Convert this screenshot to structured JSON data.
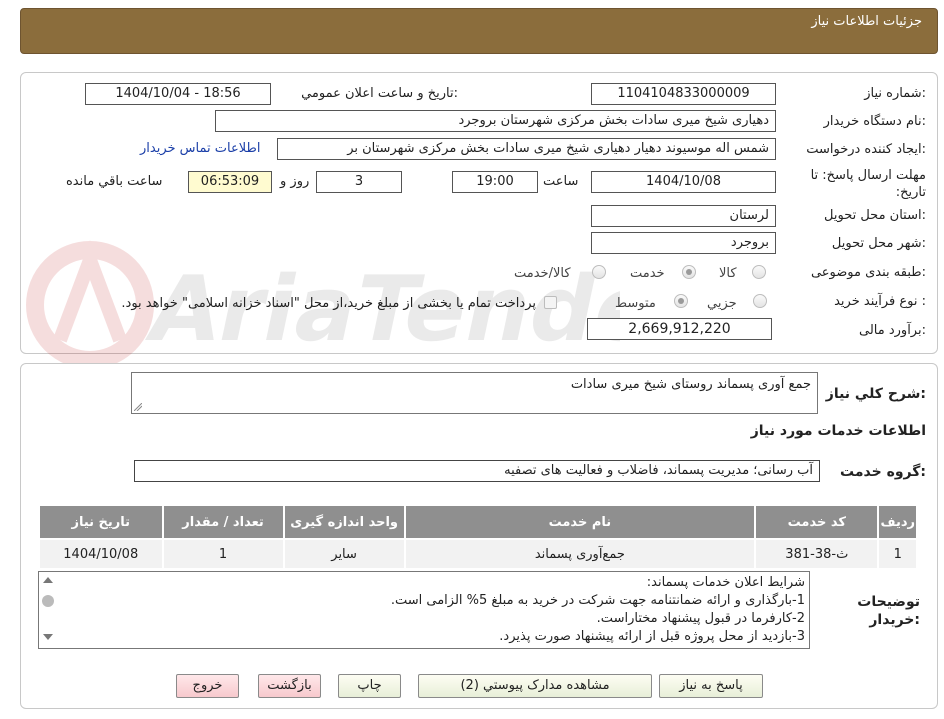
{
  "header": {
    "title": "جزئیات اطلاعات نیاز"
  },
  "form": {
    "need_number": {
      "label": "شماره نیاز:",
      "value": "1104104833000009"
    },
    "announce_datetime": {
      "label": "تاريخ و ساعت اعلان عمومي:",
      "value": "1404/10/04 - 18:56"
    },
    "buyer_org": {
      "label": "نام دستگاه خريدار:",
      "value": "دهیاری شیخ میری سادات بخش مرکزی شهرستان بروجرد"
    },
    "requester": {
      "label": "ایجاد کننده درخواست:",
      "value": "شمس اله موسیوند دهیار دهیاری شیخ میری سادات بخش مرکزی شهرستان بر",
      "contact_link": "اطلاعات تماس خریدار"
    },
    "deadline": {
      "label": "مهلت ارسال پاسخ: تا تاریخ:",
      "date": "1404/10/08",
      "time_label": "ساعت",
      "time": "19:00",
      "days": "3",
      "days_label": "روز و",
      "remaining": "06:53:09",
      "remaining_label": "ساعت باقي مانده"
    },
    "province": {
      "label": "استان محل تحویل:",
      "value": "لرستان"
    },
    "city": {
      "label": "شهر محل تحویل:",
      "value": "بروجرد"
    },
    "category": {
      "label": "طبقه بندی موضوعی:",
      "options": [
        "کالا",
        "خدمت",
        "کالا/خدمت"
      ],
      "selected": "خدمت"
    },
    "purchase_process": {
      "label": "نوع فرآیند خرید :",
      "options": [
        "جزیي",
        "متوسط"
      ],
      "selected": "متوسط",
      "treasury_note": "پرداخت تمام یا بخشی از مبلغ خرید،از محل \"اسناد خزانه اسلامی\" خواهد بود."
    },
    "budget": {
      "label": "برآورد مالی:",
      "value": "2,669,912,220"
    }
  },
  "details": {
    "general_desc_label": "شرح کلي نياز:",
    "general_desc": "جمع آوری پسماند روستای شیخ میری سادات",
    "services_title": "اطلاعات خدمات مورد نياز",
    "service_group_label": "گروه خدمت:",
    "service_group": "آب رسانی؛ مدیریت پسماند، فاضلاب و فعالیت های تصفیه",
    "table": {
      "headers": [
        "ردیف",
        "کد خدمت",
        "نام خدمت",
        "واحد اندازه گیری",
        "تعداد / مقدار",
        "تاریخ نیاز"
      ],
      "rows": [
        [
          "1",
          "ث-38-381",
          "جمع‌آوری پسماند",
          "سایر",
          "1",
          "1404/10/08"
        ]
      ]
    },
    "buyer_notes_label": "توضیحات خریدار:",
    "buyer_notes": [
      "شرایط اعلان خدمات پسماند:",
      "1-بارگذاری و ارائه ضمانتنامه جهت شرکت در خرید به مبلغ 5% الزامی است.",
      "2-کارفرما در قبول پیشنهاد مختاراست.",
      "3-بازدید از محل پروژه قبل از ارائه پیشنهاد صورت پذیرد."
    ]
  },
  "buttons": {
    "reply": "پاسخ به نیاز",
    "attachments": "مشاهده مدارک پیوستي (2)",
    "print": "چاپ",
    "back": "بازگشت",
    "exit": "خروج"
  },
  "colors": {
    "header_bg": "#8b6d3c",
    "table_header_bg": "#8f8f8f",
    "link": "#1b3fa8",
    "remaining_bg": "#fffbd0"
  }
}
